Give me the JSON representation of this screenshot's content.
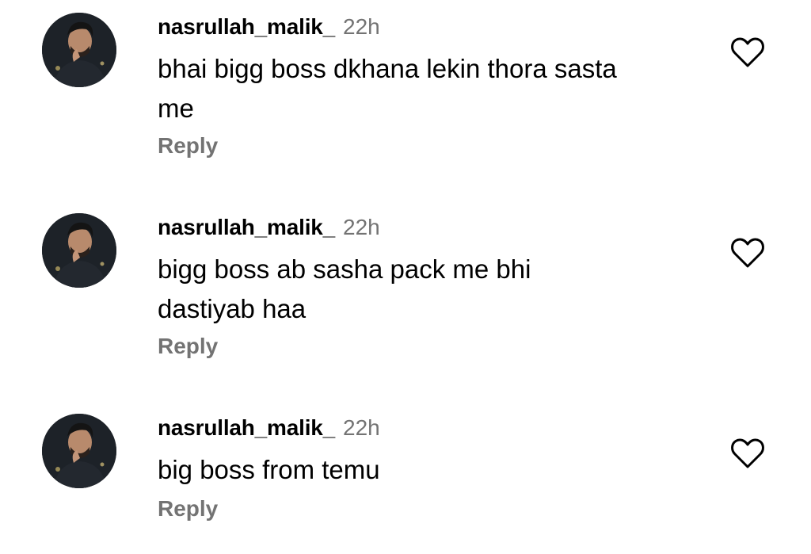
{
  "comments": [
    {
      "username": "nasrullah_malik_",
      "time": "22h",
      "text": "bhai bigg boss dkhana lekin thora sasta me",
      "reply_label": "Reply"
    },
    {
      "username": "nasrullah_malik_",
      "time": "22h",
      "text": "bigg boss ab sasha pack me bhi dastiyab haa",
      "reply_label": "Reply"
    },
    {
      "username": "nasrullah_malik_",
      "time": "22h",
      "text": "big boss from temu",
      "reply_label": "Reply"
    }
  ],
  "icons": {
    "like": "heart-outline-icon"
  },
  "colors": {
    "text": "#000000",
    "secondary": "#737373",
    "background": "#ffffff"
  }
}
